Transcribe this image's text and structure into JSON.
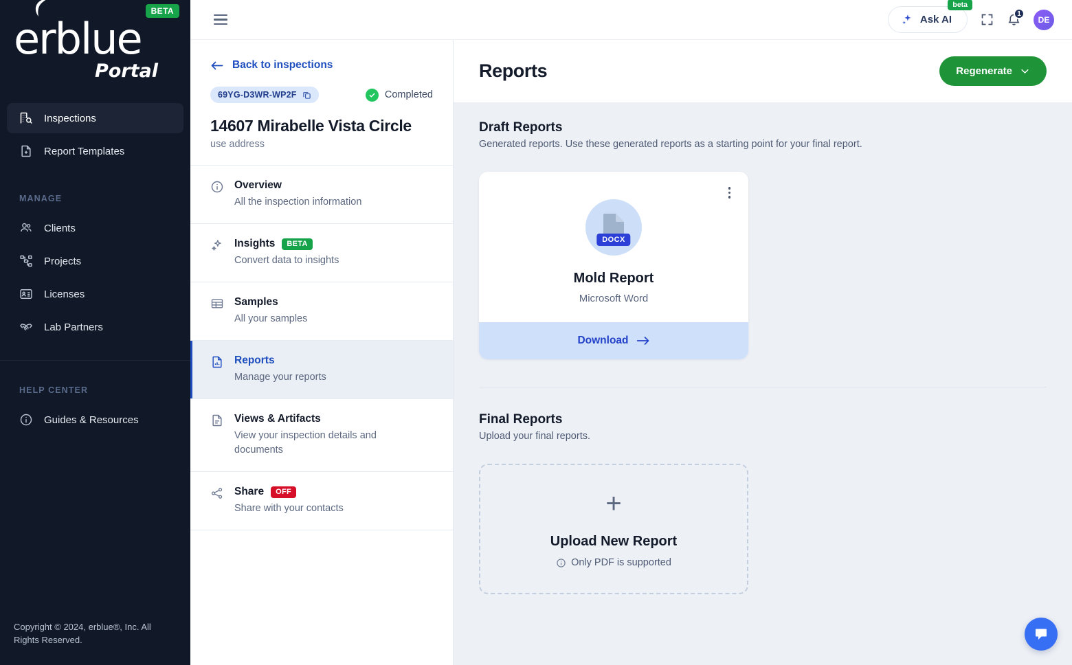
{
  "sidebar": {
    "logo": {
      "brand": "erblue",
      "sub": "Portal",
      "badge": "BETA"
    },
    "primary_items": [
      {
        "label": "Inspections",
        "icon": "building-search-icon",
        "active": true
      },
      {
        "label": "Report Templates",
        "icon": "file-plus-icon",
        "active": false
      }
    ],
    "manage_label": "MANAGE",
    "manage_items": [
      {
        "label": "Clients",
        "icon": "users-icon"
      },
      {
        "label": "Projects",
        "icon": "sitemap-icon"
      },
      {
        "label": "Licenses",
        "icon": "id-card-icon"
      },
      {
        "label": "Lab Partners",
        "icon": "handshake-icon"
      }
    ],
    "help_label": "HELP CENTER",
    "help_items": [
      {
        "label": "Guides & Resources",
        "icon": "info-circle-icon"
      }
    ],
    "copyright": "Copyright © 2024, erblue®, Inc. All Rights Reserved."
  },
  "topbar": {
    "menu_icon": "hamburger-icon",
    "ask_ai_label": "Ask AI",
    "ask_ai_badge": "beta",
    "expand_icon": "expand-icon",
    "bell_icon": "bell-icon",
    "notification_count": "1",
    "avatar_initials": "DE"
  },
  "inspection": {
    "back_label": "Back to inspections",
    "code": "69YG-D3WR-WP2F",
    "copy_icon": "copy-icon",
    "status": "Completed",
    "title": "14607 Mirabelle Vista Circle",
    "subtitle": "use address",
    "nav_items": [
      {
        "title": "Overview",
        "desc": "All the inspection information",
        "icon": "info-circle-icon",
        "badge": null,
        "badge_type": null,
        "active": false
      },
      {
        "title": "Insights",
        "desc": "Convert data to insights",
        "icon": "sparkles-icon",
        "badge": "BETA",
        "badge_type": "beta",
        "active": false
      },
      {
        "title": "Samples",
        "desc": "All your samples",
        "icon": "table-icon",
        "badge": null,
        "badge_type": null,
        "active": false
      },
      {
        "title": "Reports",
        "desc": "Manage your reports",
        "icon": "file-chart-icon",
        "badge": null,
        "badge_type": null,
        "active": true
      },
      {
        "title": "Views & Artifacts",
        "desc": "View your inspection details and documents",
        "icon": "file-lines-icon",
        "badge": null,
        "badge_type": null,
        "active": false
      },
      {
        "title": "Share",
        "desc": "Share with your contacts",
        "icon": "share-icon",
        "badge": "OFF",
        "badge_type": "off",
        "active": false
      }
    ]
  },
  "reports": {
    "page_title": "Reports",
    "regenerate_label": "Regenerate",
    "regenerate_caret": "chevron-down-icon",
    "draft": {
      "title": "Draft Reports",
      "desc": "Generated reports. Use these generated reports as a starting point for your final report.",
      "cards": [
        {
          "name": "Mold Report",
          "type": "Microsoft Word",
          "format_badge": "DOCX",
          "download_label": "Download",
          "kebab_icon": "kebab-menu-icon"
        }
      ]
    },
    "final": {
      "title": "Final Reports",
      "desc": "Upload your final reports.",
      "upload_plus": "+",
      "upload_title": "Upload New Report",
      "upload_note": "Only PDF is supported",
      "upload_note_icon": "info-circle-icon"
    }
  },
  "chat": {
    "icon": "chat-bubble-icon"
  },
  "colors": {
    "sidebar_bg": "#111827",
    "accent_blue": "#1f4fbf",
    "green": "#16a34a",
    "regen_green": "#1e9338",
    "red": "#d60e27",
    "main_bg": "#edf0f5"
  }
}
